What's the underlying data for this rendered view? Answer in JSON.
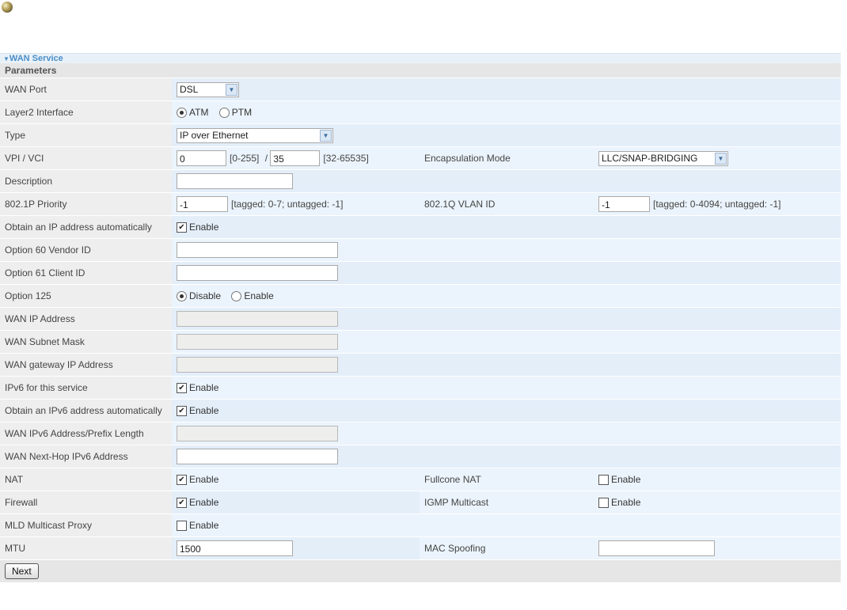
{
  "section_title": "WAN Service",
  "params_title": "Parameters",
  "wan_port": {
    "label": "WAN Port",
    "value": "DSL"
  },
  "layer2": {
    "label": "Layer2 Interface",
    "opt1": "ATM",
    "opt2": "PTM",
    "selected": "ATM"
  },
  "type": {
    "label": "Type",
    "value": "IP over Ethernet"
  },
  "vpi_vci": {
    "label": "VPI / VCI",
    "vpi": "0",
    "vpi_hint": "[0-255]",
    "sep": "/",
    "vci": "35",
    "vci_hint": "[32-65535]"
  },
  "encap": {
    "label": "Encapsulation Mode",
    "value": "LLC/SNAP-BRIDGING"
  },
  "description": {
    "label": "Description",
    "value": ""
  },
  "priority": {
    "label": "802.1P Priority",
    "value": "-1",
    "hint": "[tagged: 0-7; untagged: -1]"
  },
  "vlan": {
    "label": "802.1Q VLAN ID",
    "value": "-1",
    "hint": "[tagged: 0-4094; untagged: -1]"
  },
  "obtain_ip": {
    "label": "Obtain an IP address automatically",
    "text": "Enable",
    "checked": true
  },
  "opt60": {
    "label": "Option 60 Vendor ID",
    "value": ""
  },
  "opt61": {
    "label": "Option 61 Client ID",
    "value": ""
  },
  "opt125": {
    "label": "Option 125",
    "opt1": "Disable",
    "opt2": "Enable",
    "selected": "Disable"
  },
  "wan_ip": {
    "label": "WAN IP Address",
    "value": ""
  },
  "wan_mask": {
    "label": "WAN Subnet Mask",
    "value": ""
  },
  "wan_gw": {
    "label": "WAN gateway IP Address",
    "value": ""
  },
  "ipv6_service": {
    "label": "IPv6 for this service",
    "text": "Enable",
    "checked": true
  },
  "obtain_ipv6": {
    "label": "Obtain an IPv6 address automatically",
    "text": "Enable",
    "checked": true
  },
  "ipv6_prefix": {
    "label": "WAN IPv6 Address/Prefix Length",
    "value": ""
  },
  "ipv6_nexthop": {
    "label": "WAN Next-Hop IPv6 Address",
    "value": ""
  },
  "nat": {
    "label": "NAT",
    "text": "Enable",
    "checked": true
  },
  "fullcone": {
    "label": "Fullcone NAT",
    "text": "Enable",
    "checked": false
  },
  "firewall": {
    "label": "Firewall",
    "text": "Enable",
    "checked": true
  },
  "igmp": {
    "label": "IGMP Multicast",
    "text": "Enable",
    "checked": false
  },
  "mld": {
    "label": "MLD Multicast Proxy",
    "text": "Enable",
    "checked": false
  },
  "mtu": {
    "label": "MTU",
    "value": "1500"
  },
  "mac": {
    "label": "MAC Spoofing",
    "value": ""
  },
  "next_button": "Next",
  "checkmark_glyph": "✔"
}
